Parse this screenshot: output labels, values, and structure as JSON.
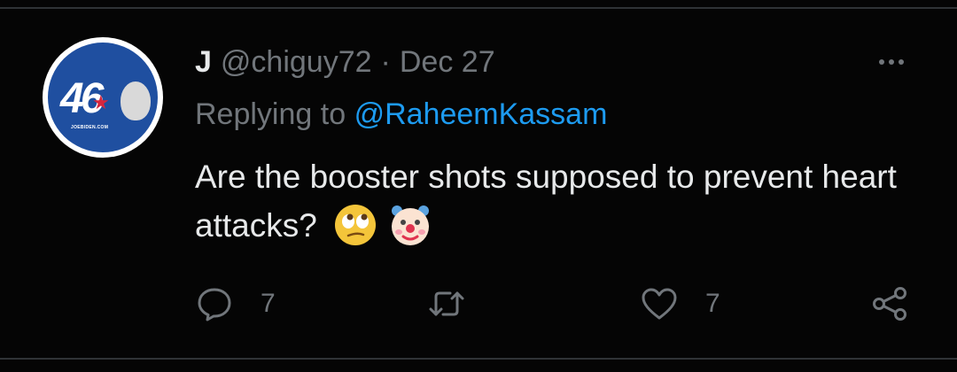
{
  "tweet": {
    "display_name": "J",
    "handle": "@chiguy72",
    "separator": "·",
    "date": "Dec 27",
    "replying_prefix": "Replying to",
    "replying_to": "@RaheemKassam",
    "text": "Are the booster shots supposed to prevent heart attacks?",
    "emojis": [
      "face-with-rolling-eyes",
      "clown-face"
    ]
  },
  "avatar": {
    "number": "46",
    "caption": "JOEBIDEN.COM",
    "colors": {
      "background": "#1f4fa0",
      "star": "#d7263d",
      "ring": "#ffffff"
    }
  },
  "actions": {
    "reply_count": "7",
    "retweet_count": "",
    "like_count": "7"
  },
  "colors": {
    "background": "#050505",
    "text": "#e7e9ea",
    "muted": "#71767b",
    "link": "#1d9bf0"
  }
}
